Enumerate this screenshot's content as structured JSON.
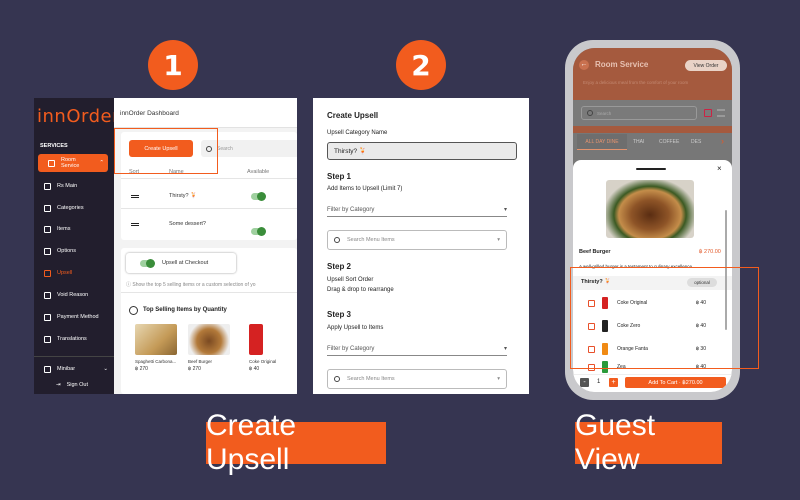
{
  "steps": {
    "one": "1",
    "two": "2"
  },
  "banners": {
    "left": "Create Upsell",
    "right": "Guest View"
  },
  "dashboard": {
    "logo": "innOrder",
    "title": "innOrder Dashboard",
    "section": "SERVICES",
    "nav": [
      {
        "label": "Room Service",
        "icon": "room-service-icon"
      },
      {
        "label": "Rs Main",
        "icon": "toggle-icon"
      },
      {
        "label": "Categories",
        "icon": "grid-icon"
      },
      {
        "label": "Items",
        "icon": "list-icon"
      },
      {
        "label": "Options",
        "icon": "options-icon"
      },
      {
        "label": "Upsell",
        "icon": "upsell-icon"
      },
      {
        "label": "Void Reason",
        "icon": "void-icon"
      },
      {
        "label": "Payment Method",
        "icon": "card-icon"
      },
      {
        "label": "Translations",
        "icon": "translate-icon"
      }
    ],
    "user": "Minibar",
    "signout": "Sign Out",
    "create_button": "Create Upsell",
    "search_placeholder": "Search",
    "cols": [
      "Sort",
      "Name",
      "Available"
    ],
    "rows": [
      "Thirsty? 🍹",
      "Some dessert?"
    ],
    "checkout_label": "Upsell at Checkout",
    "info_text": "Show the top 5 selling items or a custom selection of yo",
    "top_selling": "Top Selling Items by Quantity",
    "items": [
      {
        "name": "Spaghetti Carbona...",
        "price": "฿ 270"
      },
      {
        "name": "Beef Burger",
        "price": "฿ 270"
      },
      {
        "name": "Coke Original",
        "price": "฿ 40"
      }
    ]
  },
  "create_form": {
    "title": "Create Upsell",
    "cat_label": "Upsell Category Name",
    "cat_value": "Thirsty? 🍹",
    "step1": "Step 1",
    "step1_desc": "Add Items to Upsell (Limit 7)",
    "filter": "Filter by Category",
    "search": "Search Menu Items",
    "step2": "Step 2",
    "step2_a": "Upsell Sort Order",
    "step2_b": "Drag & drop to rearrange",
    "step3": "Step 3",
    "step3_desc": "Apply Upsell to Items",
    "filter2": "Filter by Category",
    "search2": "Search Menu Items"
  },
  "guest": {
    "header": "Room Service",
    "view_order": "View Order",
    "subtitle": "Enjoy a delicious meal from the comfort of your room",
    "search": "Search",
    "tabs": [
      "ALL DAY DINE",
      "THAI",
      "COFFEE",
      "DES"
    ],
    "item_name": "Beef Burger",
    "item_price": "฿ 270.00",
    "item_desc": "A well-grilled burger is a testament to culinary excellence",
    "upsell_title": "Thirsty? 🍹",
    "optional": "optional",
    "options": [
      {
        "name": "Coke Original",
        "price": "฿ 40",
        "color": "#d52222"
      },
      {
        "name": "Coke Zero",
        "price": "฿ 40",
        "color": "#222222"
      },
      {
        "name": "Orange Fanta",
        "price": "฿ 30",
        "color": "#f08a14"
      },
      {
        "name": "Zea",
        "price": "฿ 40",
        "color": "#2a9a3a"
      }
    ],
    "qty": "1",
    "minus": "-",
    "plus": "+",
    "add_to_cart": "Add To Cart · ฿270.00"
  },
  "colors": {
    "accent": "#f25c1e",
    "background": "#363551",
    "sidebar": "#221e2d"
  }
}
